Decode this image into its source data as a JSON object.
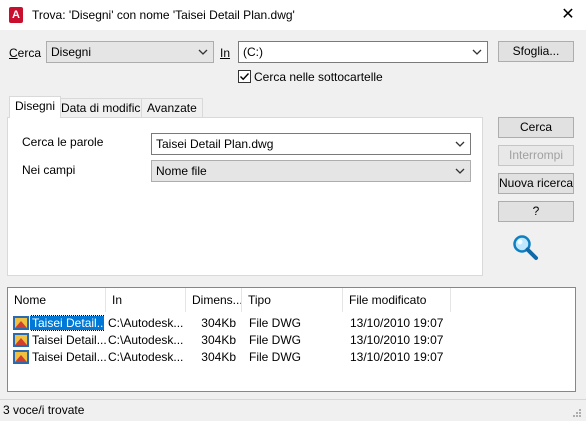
{
  "window": {
    "title": "Trova: 'Disegni' con nome 'Taisei Detail Plan.dwg'",
    "app_icon_letter": "A",
    "close_glyph": "✕"
  },
  "search_bar": {
    "cerca_label": "Cerca",
    "cerca_value": "Disegni",
    "in_label": "In",
    "in_value": "(C:)",
    "browse_button": "Sfoglia...",
    "subfolders_label": "Cerca nelle sottocartelle",
    "subfolders_checked": true
  },
  "tabs": [
    "Disegni",
    "Data di modifica",
    "Avanzate"
  ],
  "disegni_tab": {
    "words_label": "Cerca le parole",
    "words_value": "Taisei Detail Plan.dwg",
    "fields_label": "Nei campi",
    "fields_value": "Nome file"
  },
  "buttons": {
    "search": "Cerca",
    "stop": "Interrompi",
    "new_search": "Nuova ricerca",
    "help": "?"
  },
  "magnifier_icon": "magnifier-icon",
  "results": {
    "columns": [
      "Nome",
      "In",
      "Dimens...",
      "Tipo",
      "File modificato"
    ],
    "rows": [
      {
        "name": "Taisei Detail...",
        "in": "C:\\Autodesk...",
        "size": "304Kb",
        "type": "File DWG",
        "modified": "13/10/2010 19:07"
      },
      {
        "name": "Taisei Detail...",
        "in": "C:\\Autodesk...",
        "size": "304Kb",
        "type": "File DWG",
        "modified": "13/10/2010 19:07"
      },
      {
        "name": "Taisei Detail...",
        "in": "C:\\Autodesk...",
        "size": "304Kb",
        "type": "File DWG",
        "modified": "13/10/2010 19:07"
      }
    ]
  },
  "status": "3 voce/i trovate",
  "colors": {
    "accent": "#0078d7",
    "app_red": "#c8102e"
  }
}
